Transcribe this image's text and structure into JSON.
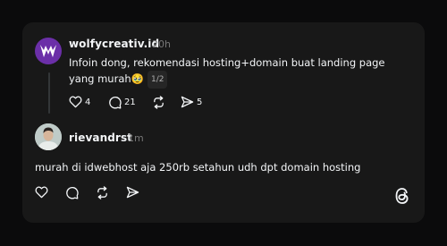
{
  "post": {
    "username": "wolfycreativ.id",
    "time": "20h",
    "text": "Infoin dong, rekomendasi hosting+domain buat landing page yang murah",
    "emoji": "🥹",
    "page_indicator": "1/2",
    "likes": "4",
    "replies": "21",
    "shares": "5"
  },
  "reply": {
    "username": "rievandrst",
    "time": "1m",
    "text": "murah di idwebhost aja 250rb setahun udh dpt domain hosting"
  },
  "icons": {
    "like": "heart-icon",
    "reply": "comment-icon",
    "repost": "repost-icon",
    "share": "send-icon",
    "brand": "threads-logo-icon"
  },
  "colors": {
    "background": "#0b0b0c",
    "card": "#181818",
    "text": "#f3f5f7",
    "muted": "#777777",
    "avatar1": "#6b2fa8"
  }
}
